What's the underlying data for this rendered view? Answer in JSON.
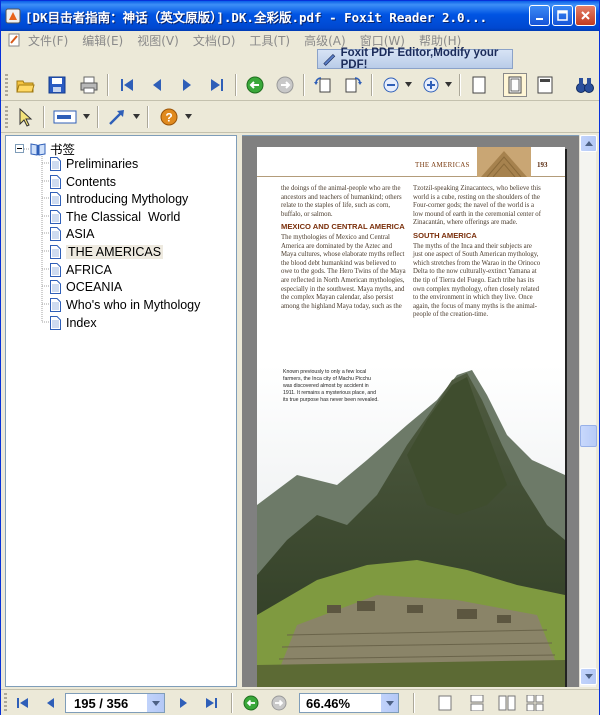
{
  "window": {
    "title": "[DK目击者指南：神话（英文原版）].DK.全彩版.pdf - Foxit Reader 2.0..."
  },
  "menu": {
    "items": [
      "文件(F)",
      "编辑(E)",
      "视图(V)",
      "文档(D)",
      "工具(T)",
      "高级(A)",
      "窗口(W)",
      "帮助(H)"
    ]
  },
  "ad_banner": "Foxit PDF Editor,Modify your PDF!",
  "bookmarks": {
    "root_label": "书签",
    "items": [
      {
        "label": "Preliminaries"
      },
      {
        "label": "Contents"
      },
      {
        "label": "Introducing Mythology"
      },
      {
        "label": "The Classical  World"
      },
      {
        "label": "ASIA"
      },
      {
        "label": "THE AMERICAS",
        "selected": true
      },
      {
        "label": "AFRICA"
      },
      {
        "label": "OCEANIA"
      },
      {
        "label": "Who's who in Mythology"
      },
      {
        "label": "Index"
      }
    ]
  },
  "page_content": {
    "section": "THE AMERICAS",
    "page_number": "193",
    "col1_intro": "the doings of the animal-people who are the ancestors and teachers of humankind; others relate to the staples of life, such as corn, buffalo, or salmon.",
    "col1_heading": "Mexico and Central America",
    "col1_body": "The mythologies of Mexico and Central America are dominated by the Aztec and Maya cultures, whose elaborate myths reflect the blood debt humankind was believed to owe to the gods. The Hero Twins of the Maya are reflected in North American mythologies, especially in the southwest. Maya myths, and the complex Mayan calendar, also persist among the highland Maya today, such as the",
    "col2_intro": "Tzotzil-speaking Zinacantecs, who believe this world is a cube, resting on the shoulders of the Four-corner gods; the navel of the world is a low mound of earth in the ceremonial center of Zinacantán, where offerings are made.",
    "col2_heading": "South America",
    "col2_body": "The myths of the Inca and their subjects are just one aspect of South American mythology, which stretches from the Warao in the Orinoco Delta to the now culturally-extinct Yamana at the tip of Tierra del Fuego. Each tribe has its own complex mythology, often closely related to the environment in which they live. Once again, the focus of many myths is the animal-people of the creation-time.",
    "caption": "Known previously to only a few local farmers, the Inca city of Machu Picchu was discovered almost by accident in 1911. It remains a mysterious place, and its true purpose has never been revealed."
  },
  "status": {
    "page_display": "195 / 356",
    "zoom": "66.46%"
  }
}
